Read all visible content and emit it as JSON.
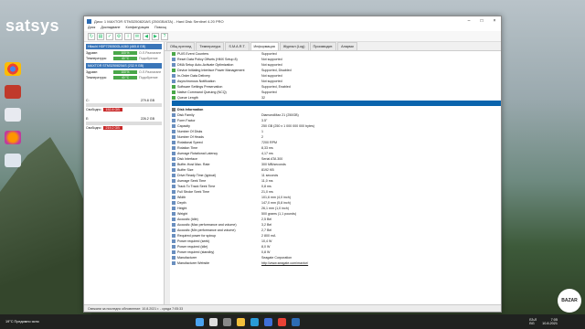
{
  "desktop": {
    "watermark": "satsys"
  },
  "window": {
    "title": "Диск: 1 MAXTOR STM3250820AS (250GB/ATA) - Hard Disk Sentinel 4.20 PRO",
    "menu": [
      "Диск",
      "Докладване",
      "Конфигурация",
      "Помощ"
    ]
  },
  "left_panel": {
    "disks": [
      {
        "header": "Hitachi HDP725050GLA360 (465.8 GB)",
        "health_label": "Здраве:",
        "health": "100 %",
        "health_note": "О.Л.Разлагане",
        "temp_label": "Температура:",
        "temp": "40 °C",
        "temp_note": "Подобрение"
      },
      {
        "header": "MAXTOR STM3250820AS (232.9 GB)",
        "health_label": "Здраве:",
        "health": "100 %",
        "health_note": "О.Л.Разлагане",
        "temp_label": "Температура:",
        "temp": "40 °C",
        "temp_note": "Подобрение"
      }
    ],
    "volumes": [
      {
        "name": "C:",
        "size": "279.8 GB",
        "free_label": "Свободно",
        "free": "152.8 GB"
      },
      {
        "name": "E:",
        "size": "226.2 GB",
        "free_label": "Свободно",
        "free": "219.2 GB"
      }
    ]
  },
  "tabs": [
    "Общ преглед",
    "Температура",
    "S.M.A.R.T.",
    "Информация",
    "Журнал (Log)",
    "Производит.",
    "Аларми"
  ],
  "features": [
    {
      "name": "PUIS Event Counters",
      "value": "Supported"
    },
    {
      "name": "Reset Data Policy Offsets (HMX Setup 8)",
      "value": "Not supported"
    },
    {
      "name": "DMA Setup Auto-Activate Optimization",
      "value": "Not supported"
    },
    {
      "name": "Device Initiating Interface Power Management",
      "value": "Supported, Disabled"
    },
    {
      "name": "In-Order Data Delivery",
      "value": "Not supported"
    },
    {
      "name": "Asynchronous Notification",
      "value": "Not supported"
    },
    {
      "name": "Software Settings Preservation",
      "value": "Supported, Enabled"
    },
    {
      "name": "Native Command Queuing (NCQ)",
      "value": "Supported"
    },
    {
      "name": "Queue Length",
      "value": "32"
    }
  ],
  "selected_row": {
    "name": "",
    "value": ""
  },
  "disk_info_title": "Disk Information",
  "disk_info": [
    {
      "name": "Disk Family",
      "value": "DiamondMax 21 (250GB)"
    },
    {
      "name": "Form Factor",
      "value": "3.5\""
    },
    {
      "name": "Capacity",
      "value": "250 GB (250 x 1 000 000 000 bytes)"
    },
    {
      "name": "Number Of Disks",
      "value": "1"
    },
    {
      "name": "Number Of Heads",
      "value": "2"
    },
    {
      "name": "Rotational Speed",
      "value": "7200 RPM"
    },
    {
      "name": "Rotation Time",
      "value": "8,33 ms"
    },
    {
      "name": "Average Rotational Latency",
      "value": "4,17 ms"
    },
    {
      "name": "Disk Interface",
      "value": "Serial ATA 300"
    },
    {
      "name": "Buffer-Host Max. Rate",
      "value": "300 MB/seconds"
    },
    {
      "name": "Buffer Size",
      "value": "8192 KB"
    },
    {
      "name": "Drive Ready Time (typical)",
      "value": "11 seconds"
    },
    {
      "name": "Average Seek Time",
      "value": "11,0 ms"
    },
    {
      "name": "Track To Track Seek Time",
      "value": "0,8 ms"
    },
    {
      "name": "Full Stroke Seek Time",
      "value": "21,0 ms"
    },
    {
      "name": "Width",
      "value": "101,6 mm (4,0 inch)"
    },
    {
      "name": "Depth",
      "value": "147,0 mm (5,8 inch)"
    },
    {
      "name": "Height",
      "value": "26,1 mm (1,0 inch)"
    },
    {
      "name": "Weight",
      "value": "500 grams (1,1 pounds)"
    },
    {
      "name": "Acoustic (Idle)",
      "value": "2,5 Bel"
    },
    {
      "name": "Acoustic (Max performance and volume)",
      "value": "3,2 Bel"
    },
    {
      "name": "Acoustic (Min performance and volume)",
      "value": "2,7 Bel"
    },
    {
      "name": "Required power for spinup",
      "value": "2 800 mA"
    },
    {
      "name": "Power required (seek)",
      "value": "10,4 W"
    },
    {
      "name": "Power required (idle)",
      "value": "8,0 W"
    },
    {
      "name": "Power required (standby)",
      "value": "0,8 W"
    },
    {
      "name": "Manufacturer",
      "value": "Seagate Corporation"
    },
    {
      "name": "Manufacturer Website",
      "value": "http://www.seagate.com/maxtor/"
    }
  ],
  "status": "Свежани за последно обновление: 10.8.2021 г. - сряда 7:05:33",
  "taskbar": {
    "weather": "19°C  Предимно ясно",
    "lang": "БЪЛ",
    "lang2": "BG",
    "time": "7:05",
    "date": "10.8.2021"
  },
  "brand": "BAZAR"
}
